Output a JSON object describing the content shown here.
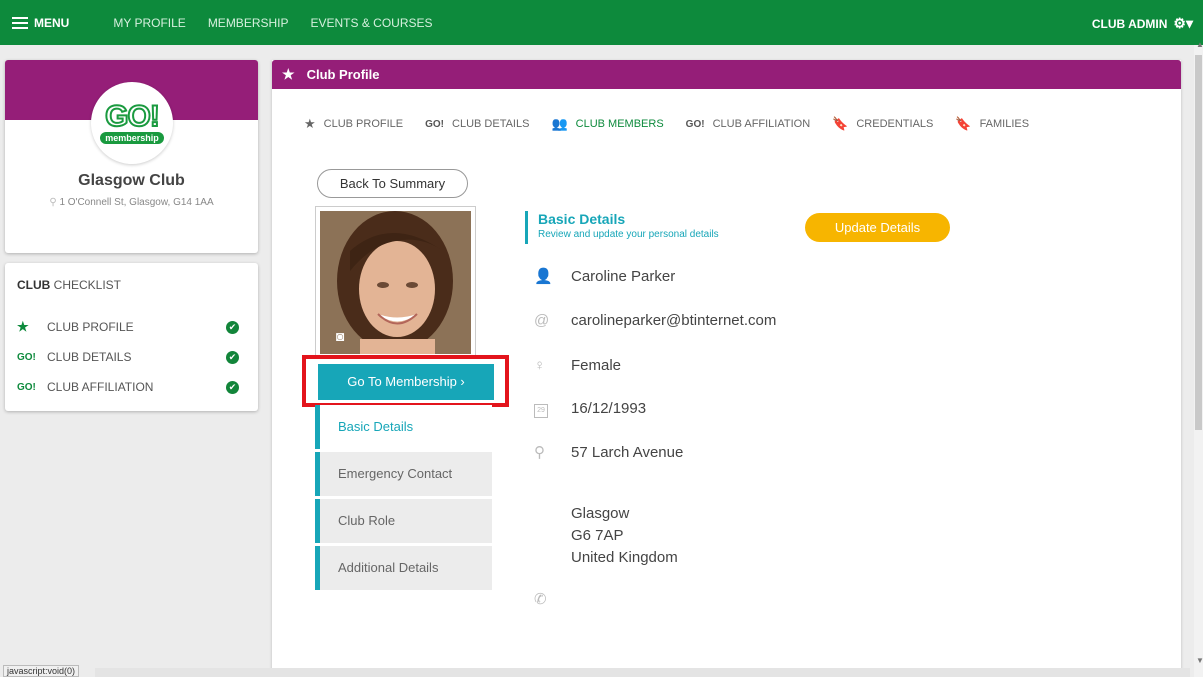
{
  "topnav": {
    "menu": "MENU",
    "links": [
      "MY PROFILE",
      "MEMBERSHIP",
      "EVENTS & COURSES"
    ],
    "admin": "CLUB ADMIN"
  },
  "club": {
    "logo_text": "GO!",
    "logo_sub": "membership",
    "name": "Glasgow Club",
    "address": "1 O'Connell St, Glasgow, G14 1AA"
  },
  "checklist": {
    "head_bold": "CLUB",
    "head_rest": " CHECKLIST",
    "items": [
      {
        "label": "CLUB PROFILE",
        "icon": "★"
      },
      {
        "label": "CLUB DETAILS",
        "icon": "GO!"
      },
      {
        "label": "CLUB AFFILIATION",
        "icon": "GO!"
      }
    ]
  },
  "panel": {
    "title": "Club Profile",
    "tabs": [
      {
        "label": "CLUB PROFILE",
        "icon": "★"
      },
      {
        "label": "CLUB DETAILS",
        "icon": "GO!"
      },
      {
        "label": "CLUB MEMBERS",
        "icon": "👥"
      },
      {
        "label": "CLUB AFFILIATION",
        "icon": "GO!"
      },
      {
        "label": "CREDENTIALS",
        "icon": "🔖"
      },
      {
        "label": "FAMILIES",
        "icon": "🔖"
      }
    ],
    "back": "Back To Summary",
    "go_membership": "Go To Membership ›",
    "side_menu": [
      "Basic Details",
      "Emergency Contact",
      "Club Role",
      "Additional Details"
    ]
  },
  "basic": {
    "title": "Basic Details",
    "subtitle": "Review and update your personal details",
    "update": "Update Details",
    "name": "Caroline Parker",
    "email": "carolineparker@btinternet.com",
    "gender": "Female",
    "dob": "16/12/1993",
    "address1": "57 Larch Avenue",
    "city": "Glasgow",
    "postcode": "G6 7AP",
    "country": "United Kingdom",
    "date_icon_day": "29"
  },
  "status": "javascript:void(0)",
  "colors": {
    "nav": "#0d8a3c",
    "purple": "#951e78",
    "teal": "#17a6b8",
    "amber": "#f7b500",
    "highlight": "#e3141c"
  }
}
